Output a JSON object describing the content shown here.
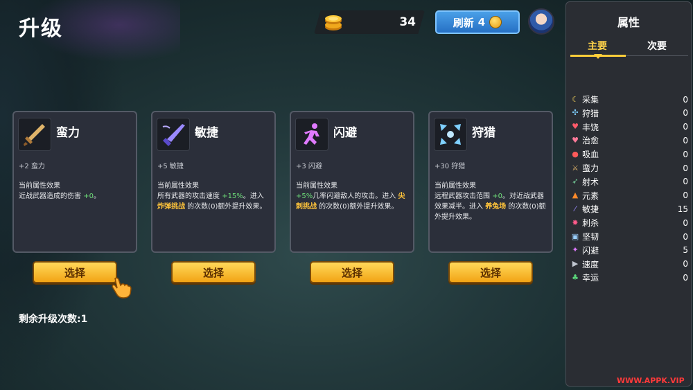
{
  "page_title": "升级",
  "currency": {
    "coins": "34"
  },
  "refresh": {
    "label": "刷新",
    "count": "4"
  },
  "cards": [
    {
      "title": "蛮力",
      "stat": "+2 蛮力",
      "effect_label": "当前属性效果",
      "desc": [
        {
          "t": "近战武器造成的伤害 "
        },
        {
          "t": "+0",
          "c": "green"
        },
        {
          "t": "。"
        }
      ],
      "select": "选择"
    },
    {
      "title": "敏捷",
      "stat": "+5 敏捷",
      "effect_label": "当前属性效果",
      "desc": [
        {
          "t": "所有武器的攻击速度 "
        },
        {
          "t": "+15%",
          "c": "green"
        },
        {
          "t": "。进入 "
        },
        {
          "t": "炸弹挑战",
          "c": "yellow"
        },
        {
          "t": " 的次数(0)额外提升效果。"
        }
      ],
      "select": "选择"
    },
    {
      "title": "闪避",
      "stat": "+3 闪避",
      "effect_label": "当前属性效果",
      "desc": [
        {
          "t": "+5%",
          "c": "green"
        },
        {
          "t": "几率闪避敌人的攻击。进入 "
        },
        {
          "t": "尖刺挑战",
          "c": "yellow"
        },
        {
          "t": " 的次数(0)额外提升效果。"
        }
      ],
      "select": "选择"
    },
    {
      "title": "狩猎",
      "stat": "+30 狩猎",
      "effect_label": "当前属性效果",
      "desc": [
        {
          "t": "远程武器攻击范围 "
        },
        {
          "t": "+0",
          "c": "green"
        },
        {
          "t": "。对近战武器效果减半。进入 "
        },
        {
          "t": "养兔场",
          "c": "yellow"
        },
        {
          "t": " 的次数(0)额外提升效果。"
        }
      ],
      "select": "选择"
    }
  ],
  "remaining_label": "剩余升级次数:1",
  "sidebar": {
    "title": "属性",
    "tabs": [
      "主要",
      "次要"
    ],
    "attributes": [
      {
        "icon": "moon-icon",
        "label": "采集",
        "value": "0",
        "color": "#f6d35a"
      },
      {
        "icon": "crosshair-icon",
        "label": "狩猎",
        "value": "0",
        "color": "#7fd0ff"
      },
      {
        "icon": "heart-icon",
        "label": "丰饶",
        "value": "0",
        "color": "#ff5a6a"
      },
      {
        "icon": "heart-plus-icon",
        "label": "治愈",
        "value": "0",
        "color": "#ff7a9a"
      },
      {
        "icon": "blood-drop-icon",
        "label": "吸血",
        "value": "0",
        "color": "#ff5a5a"
      },
      {
        "icon": "sword-icon",
        "label": "蛮力",
        "value": "0",
        "color": "#e0b46a"
      },
      {
        "icon": "bow-icon",
        "label": "射术",
        "value": "0",
        "color": "#7ad7a0"
      },
      {
        "icon": "flame-icon",
        "label": "元素",
        "value": "0",
        "color": "#ff8a2a"
      },
      {
        "icon": "blade-icon",
        "label": "敏捷",
        "value": "15",
        "color": "#9a8aff"
      },
      {
        "icon": "burst-icon",
        "label": "刺杀",
        "value": "0",
        "color": "#ff5a8a"
      },
      {
        "icon": "armor-icon",
        "label": "坚韧",
        "value": "0",
        "color": "#9ad0ff"
      },
      {
        "icon": "runner-icon",
        "label": "闪避",
        "value": "5",
        "color": "#e07aff"
      },
      {
        "icon": "boot-icon",
        "label": "速度",
        "value": "0",
        "color": "#c0c6d0"
      },
      {
        "icon": "clover-icon",
        "label": "幸运",
        "value": "0",
        "color": "#5ad67a"
      }
    ]
  },
  "watermark": "WWW.APPK.VIP"
}
